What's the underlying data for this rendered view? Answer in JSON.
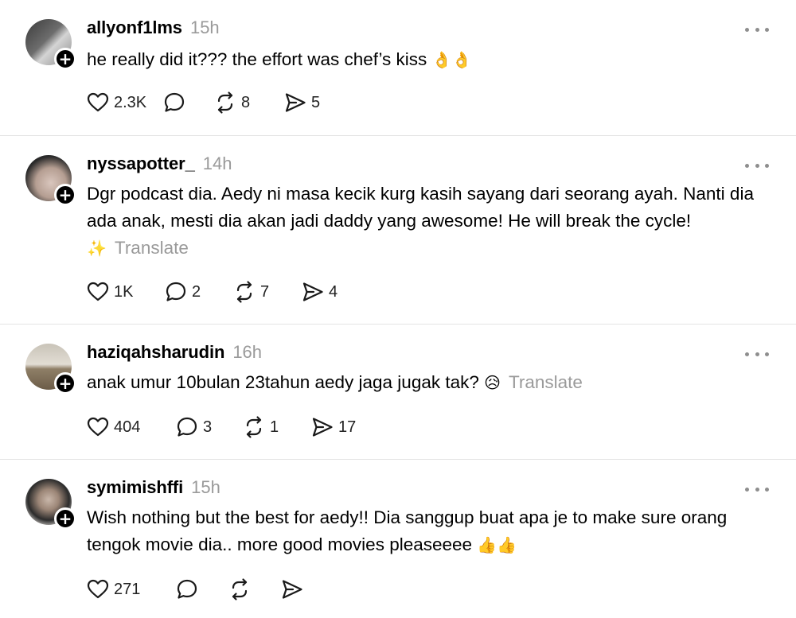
{
  "posts": [
    {
      "username": "allyonf1lms",
      "time": "15h",
      "text": "he really did it??? the effort was chef’s kiss ",
      "emoji": "👌👌",
      "translate": "",
      "likes": "2.3K",
      "replies": "",
      "reposts": "8",
      "shares": "5",
      "avatar_colors": [
        "#3a3a3a",
        "#cfcfcf"
      ]
    },
    {
      "username": "nyssapotter_",
      "time": "14h",
      "text": "Dgr podcast dia. Aedy ni masa kecik kurg kasih sayang dari seorang ayah. Nanti dia ada anak, mesti dia akan jadi daddy yang awesome! He will break the cycle!",
      "emoji": "✨",
      "translate": "Translate",
      "likes": "1K",
      "replies": "2",
      "reposts": "7",
      "shares": "4",
      "avatar_colors": [
        "#222222",
        "#d9c6bd"
      ]
    },
    {
      "username": "haziqahsharudin",
      "time": "16h",
      "text": "anak umur 10bulan 23tahun aedy jaga jugak tak? ",
      "emoji": "😥",
      "translate": "Translate",
      "likes": "404",
      "replies": "3",
      "reposts": "1",
      "shares": "17",
      "avatar_colors": [
        "#9a8a72",
        "#e2ddd4"
      ]
    },
    {
      "username": "symimishffi",
      "time": "15h",
      "text": "Wish nothing but the best for aedy!! Dia sanggup buat apa je to make sure orang tengok movie dia.. more good movies pleaseeee ",
      "emoji": "👍👍",
      "translate": "",
      "likes": "271",
      "replies": "",
      "reposts": "",
      "shares": "",
      "avatar_colors": [
        "#2b2b2b",
        "#c9b7aa"
      ]
    }
  ],
  "icons": {
    "like": "heart-icon",
    "reply": "comment-icon",
    "repost": "repost-icon",
    "share": "send-icon",
    "more": "more-options-icon",
    "follow": "follow-plus-icon"
  },
  "follow_symbol": "+"
}
